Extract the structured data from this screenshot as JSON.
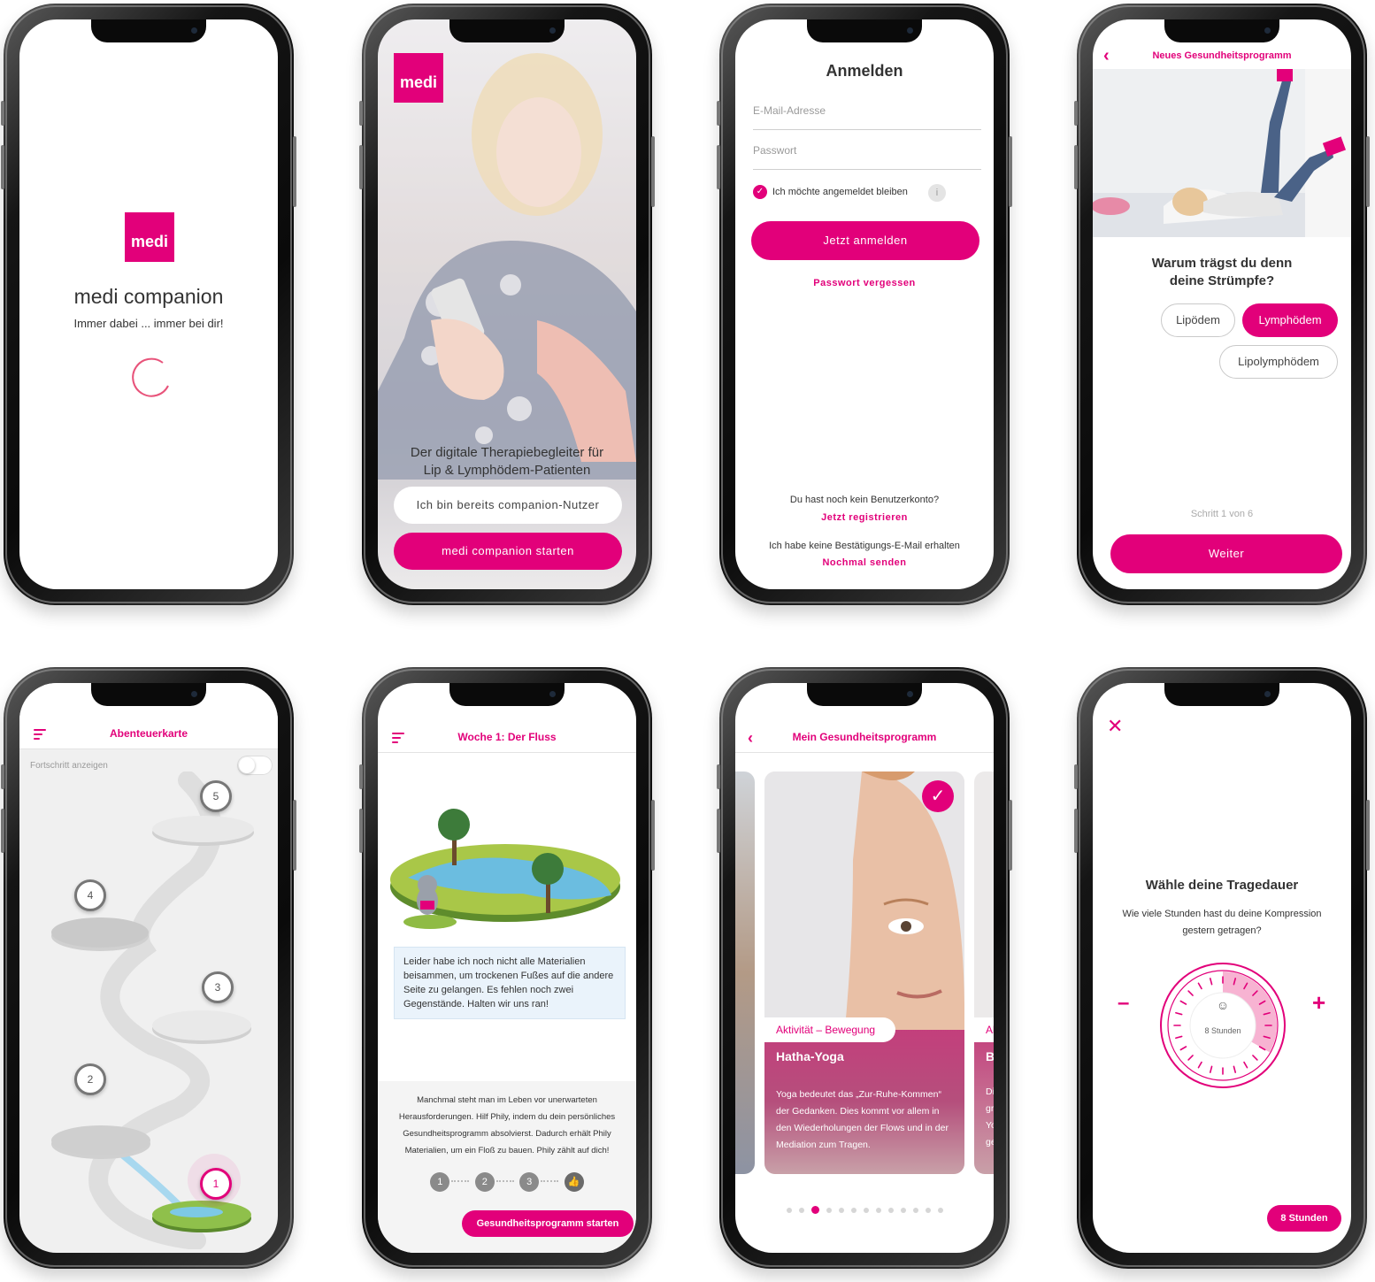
{
  "brand": {
    "logo_text": "medi",
    "accent": "#e2007a"
  },
  "splash": {
    "app_name": "medi companion",
    "tagline": "Immer dabei ... immer bei dir!"
  },
  "welcome": {
    "headline": "Der digitale Therapiebegleiter für Lip & Lymphödem-Patienten",
    "existing_user_button": "Ich bin bereits companion-Nutzer",
    "start_button": "medi companion starten"
  },
  "login": {
    "title": "Anmelden",
    "email_placeholder": "E-Mail-Adresse",
    "password_placeholder": "Passwort",
    "remember_label": "Ich möchte angemeldet bleiben",
    "info_icon": "i",
    "login_button": "Jetzt anmelden",
    "forgot_link": "Passwort vergessen",
    "no_account_text": "Du hast noch kein Benutzerkonto?",
    "register_link": "Jetzt registrieren",
    "no_email_text": "Ich habe keine Bestätigungs-E-Mail erhalten",
    "resend_link": "Nochmal senden"
  },
  "program_setup": {
    "title": "Neues Gesundheitsprogramm",
    "question": "Warum trägst du denn deine Strümpfe?",
    "options": [
      "Lipödem",
      "Lymphödem",
      "Lipolymphödem"
    ],
    "selected": "Lymphödem",
    "step_text": "Schritt 1 von 6",
    "next_button": "Weiter"
  },
  "adventure_map": {
    "title": "Abenteuerkarte",
    "progress_toggle_label": "Fortschritt anzeigen",
    "stages": [
      "5",
      "4",
      "3",
      "2",
      "1"
    ]
  },
  "week": {
    "title": "Woche 1: Der Fluss",
    "speech": "Leider habe ich noch nicht alle Materialien beisammen, um trockenen Fußes auf die andere Seite zu gelangen. Es fehlen noch zwei Gegenstände. Halten wir uns ran!",
    "intro": "Manchmal steht man im Leben vor unerwarteten Herausforderungen. Hilf Phily, indem du dein persönliches Gesundheitsprogramm absolvierst. Dadurch erhält Phily Materialien, um ein Floß zu bauen. Phily zählt auf dich!",
    "steps": [
      "1",
      "2",
      "3"
    ],
    "start_button": "Gesundheitsprogramm starten"
  },
  "my_program": {
    "title": "Mein Gesundheitsprogramm",
    "card_category": "Aktivität – Bewegung",
    "card_title": "Hatha-Yoga",
    "card_text": "Yoga bedeutet das „Zur-Ruhe-Kommen“ der Gedanken. Dies kommt vor allem in den Wiederholungen der Flows und in der Mediation zum Tragen.",
    "next_card_category_cut": "Ak",
    "next_card_title_cut": "Be",
    "next_card_text_cut": [
      "Die",
      "gru",
      "Yo",
      "ges"
    ],
    "page_count": 13,
    "active_page": 3
  },
  "duration": {
    "title": "Wähle deine Tragedauer",
    "question": "Wie viele Stunden hast du deine Kompression gestern getragen?",
    "dial_value": "8 Stunden",
    "hours_fraction": 0.333,
    "minus": "–",
    "plus": "+",
    "badge": "8 Stunden"
  }
}
